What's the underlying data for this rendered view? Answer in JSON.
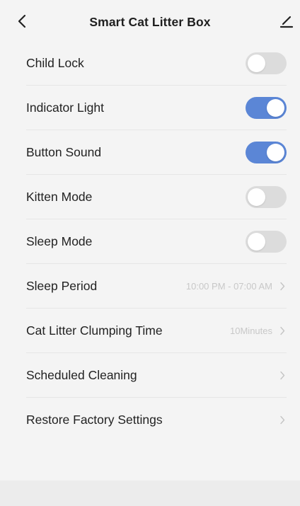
{
  "header": {
    "title": "Smart Cat Litter Box",
    "back_icon": "chevron-left-icon",
    "edit_icon": "pencil-icon"
  },
  "colors": {
    "toggle_on": "#5b86d6",
    "toggle_off": "#dcdcdc",
    "value_text": "#c8c8c8"
  },
  "settings": [
    {
      "label": "Child Lock",
      "type": "toggle",
      "on": false
    },
    {
      "label": "Indicator Light",
      "type": "toggle",
      "on": true
    },
    {
      "label": "Button Sound",
      "type": "toggle",
      "on": true
    },
    {
      "label": "Kitten Mode",
      "type": "toggle",
      "on": false
    },
    {
      "label": "Sleep Mode",
      "type": "toggle",
      "on": false
    },
    {
      "label": "Sleep Period",
      "type": "link",
      "value": "10:00 PM - 07:00 AM"
    },
    {
      "label": "Cat Litter Clumping Time",
      "type": "link",
      "value": "10Minutes"
    },
    {
      "label": "Scheduled Cleaning",
      "type": "link",
      "value": ""
    },
    {
      "label": "Restore Factory Settings",
      "type": "link",
      "value": ""
    }
  ]
}
